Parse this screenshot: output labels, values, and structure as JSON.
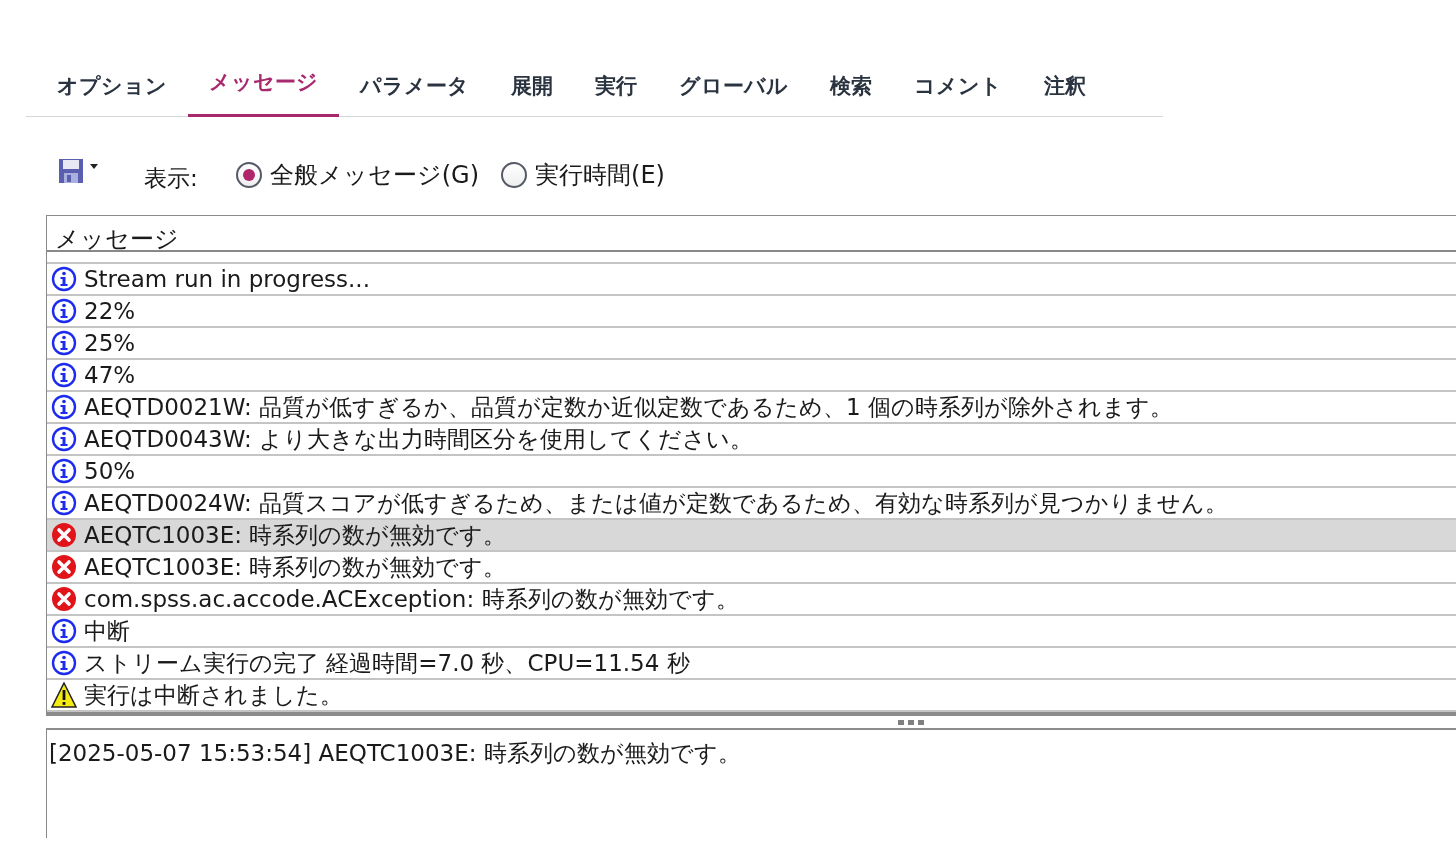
{
  "tabs": [
    {
      "label": "オプション",
      "selected": false
    },
    {
      "label": "メッセージ",
      "selected": true
    },
    {
      "label": "パラメータ",
      "selected": false
    },
    {
      "label": "展開",
      "selected": false
    },
    {
      "label": "実行",
      "selected": false
    },
    {
      "label": "グローバル",
      "selected": false
    },
    {
      "label": "検索",
      "selected": false
    },
    {
      "label": "コメント",
      "selected": false
    },
    {
      "label": "注釈",
      "selected": false
    }
  ],
  "toolbar": {
    "show_label": "表示:",
    "options": [
      {
        "label": "全般メッセージ(G)",
        "selected": true
      },
      {
        "label": "実行時間(E)",
        "selected": false
      }
    ]
  },
  "table": {
    "columns": [
      "メッセージ"
    ],
    "rows": [
      {
        "kind": "info",
        "text": "Stream run in progress...",
        "selected": false
      },
      {
        "kind": "info",
        "text": "22%",
        "selected": false
      },
      {
        "kind": "info",
        "text": "25%",
        "selected": false
      },
      {
        "kind": "info",
        "text": "47%",
        "selected": false
      },
      {
        "kind": "info",
        "text": "AEQTD0021W: 品質が低すぎるか、品質が定数か近似定数であるため、1 個の時系列が除外されます。",
        "selected": false
      },
      {
        "kind": "info",
        "text": "AEQTD0043W: より大きな出力時間区分を使用してください。",
        "selected": false
      },
      {
        "kind": "info",
        "text": "50%",
        "selected": false
      },
      {
        "kind": "info",
        "text": "AEQTD0024W: 品質スコアが低すぎるため、または値が定数であるため、有効な時系列が見つかりません。",
        "selected": false
      },
      {
        "kind": "error",
        "text": "AEQTC1003E: 時系列の数が無効です。",
        "selected": true
      },
      {
        "kind": "error",
        "text": "AEQTC1003E: 時系列の数が無効です。",
        "selected": false
      },
      {
        "kind": "error",
        "text": "com.spss.ac.accode.ACException: 時系列の数が無効です。",
        "selected": false
      },
      {
        "kind": "info",
        "text": "中断",
        "selected": false
      },
      {
        "kind": "info",
        "text": "ストリーム実行の完了 経過時間=7.0 秒、CPU=11.54 秒",
        "selected": false
      },
      {
        "kind": "warning",
        "text": "実行は中断されました。",
        "selected": false
      }
    ]
  },
  "detail": {
    "text": "[2025-05-07 15:53:54] AEQTC1003E: 時系列の数が無効です。"
  }
}
